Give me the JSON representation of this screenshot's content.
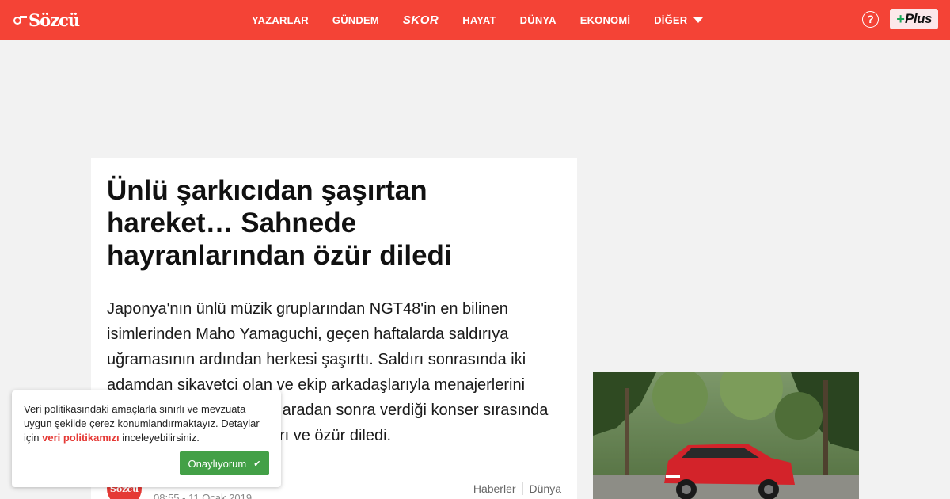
{
  "header": {
    "logo_text": "Sözcü",
    "nav": [
      {
        "label": "YAZARLAR"
      },
      {
        "label": "GÜNDEM"
      },
      {
        "label": "SKOR"
      },
      {
        "label": "HAYAT"
      },
      {
        "label": "DÜNYA"
      },
      {
        "label": "EKONOMİ"
      },
      {
        "label": "DİĞER"
      }
    ],
    "help_glyph": "?",
    "plus_label": "Plus",
    "brand_color": "#f44336"
  },
  "article": {
    "title": "Ünlü şarkıcıdan şaşırtan hareket… Sahnede hayranlarından özür diledi",
    "lead": "Japonya'nın ünlü müzik gruplarından NGT48'in en bilinen isimlerinden Maho Yamaguchi, geçen haftalarda saldırıya uğramasının ardından herkesi şaşırttı. Saldırı sonrasında iki adamdan şikayetçi olan ve ekip arkadaşlarıyla menajerlerini suçlayan Yamaguchi, bir aradan sonra verdiği konser sırasında hayranlarından gözyaşları ve özür diledi.",
    "avatar_text": "Sözcü",
    "date": "08:55 - 11 Ocak 2019",
    "categories": [
      "Haberler",
      "Dünya"
    ]
  },
  "cookie": {
    "text_before": "Veri politikasındaki amaçlarla sınırlı ve mevzuata uygun şekilde çerez konumlandırmaktayız. Detaylar için ",
    "link": "veri politikamızı",
    "text_after": " inceleyebilirsiniz.",
    "button": "Onaylıyorum",
    "button_color": "#43a047"
  }
}
